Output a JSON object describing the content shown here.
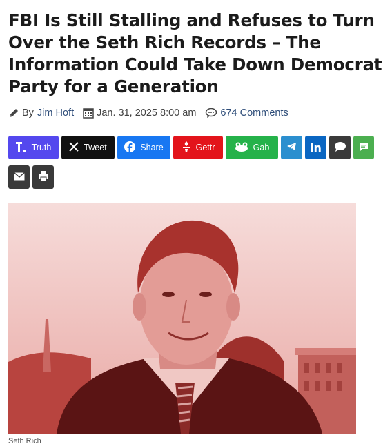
{
  "article": {
    "headline_lines": [
      "FBI Is Still Stalling and Refuses to Turn",
      "Over the Seth Rich Records – The",
      "Information Could Take Down Democrat",
      "Party for a Generation"
    ],
    "byline_prefix": "By",
    "author": "Jim Hoft",
    "date": "Jan. 31, 2025 8:00 am",
    "comments": "674 Comments",
    "image_caption": "Seth Rich"
  },
  "share_buttons": [
    {
      "label": "Truth",
      "icon": "truth-social-icon",
      "color": "#5448ee"
    },
    {
      "label": "Tweet",
      "icon": "x-logo-icon",
      "color": "#111111"
    },
    {
      "label": "Share",
      "icon": "facebook-icon",
      "color": "#1877f2"
    },
    {
      "label": "Gettr",
      "icon": "gettr-icon",
      "color": "#e3141b"
    },
    {
      "label": "Gab",
      "icon": "gab-frog-icon",
      "color": "#25b24a"
    },
    {
      "label": "",
      "icon": "telegram-icon",
      "color": "#2b8fcf"
    },
    {
      "label": "",
      "icon": "linkedin-icon",
      "color": "#0a66c2"
    },
    {
      "label": "",
      "icon": "speech-bubble-icon",
      "color": "#3a3a3a"
    },
    {
      "label": "",
      "icon": "sms-message-icon",
      "color": "#4caf50"
    },
    {
      "label": "",
      "icon": "email-icon",
      "color": "#3a3a3a"
    },
    {
      "label": "",
      "icon": "print-icon",
      "color": "#3a3a3a"
    }
  ]
}
